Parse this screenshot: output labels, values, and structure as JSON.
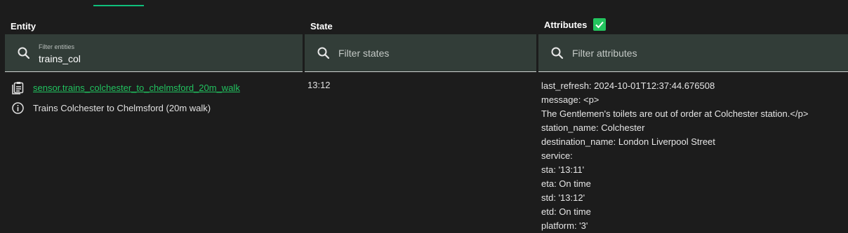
{
  "header": {
    "entity": "Entity",
    "state": "State",
    "attributes": "Attributes",
    "attributes_checked": true
  },
  "filters": {
    "entity": {
      "label": "Filter entities",
      "value": "trains_col"
    },
    "state": {
      "placeholder": "Filter states"
    },
    "attributes": {
      "placeholder": "Filter attributes"
    }
  },
  "row": {
    "entity_id": "sensor.trains_colchester_to_chelmsford_20m_walk",
    "friendly_name": "Trains Colchester to Chelmsford (20m walk)",
    "state": "13:12",
    "attributes": [
      "last_refresh: 2024-10-01T12:37:44.676508",
      "message: <p>",
      "The Gentlemen's toilets are out of order at Colchester station.</p>",
      "station_name: Colchester",
      "destination_name: London Liverpool Street",
      "service:",
      "sta: '13:11'",
      "eta: On time",
      "std: '13:12'",
      "etd: On time",
      "platform: '3'"
    ]
  },
  "colors": {
    "background": "#1c1c1c",
    "filter_bg": "#323d38",
    "accent_green": "#21c25f",
    "checkbox_green": "#23c45e"
  },
  "icons": {
    "entity_copy": "clipboard-icon",
    "info": "info-icon",
    "search": "search-icon",
    "check": "check-icon"
  }
}
